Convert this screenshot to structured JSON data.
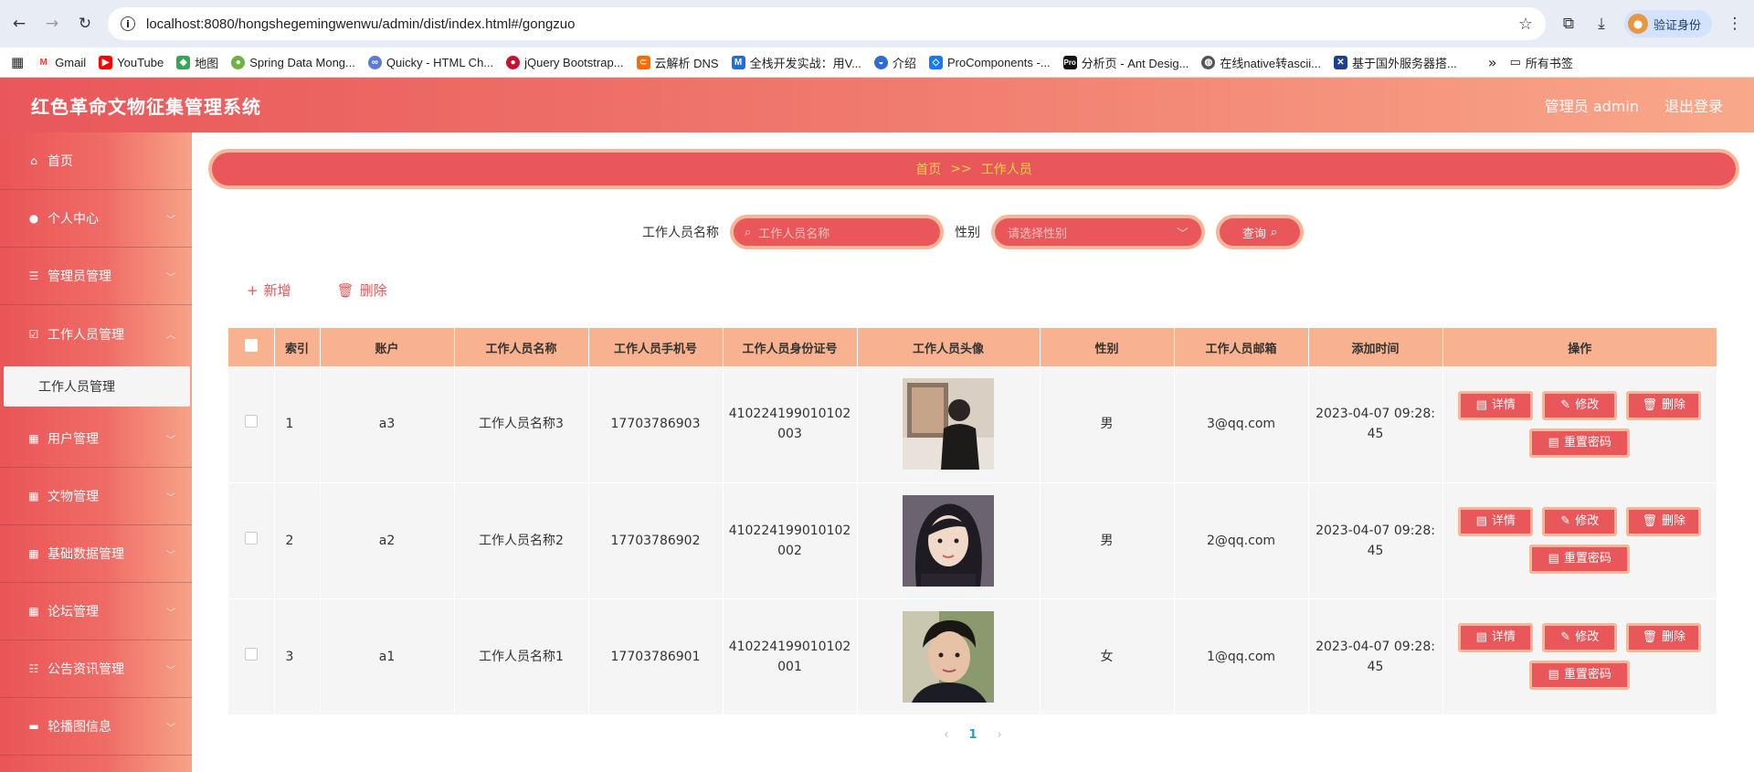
{
  "browser": {
    "url": "localhost:8080/hongshegemingwenwu/admin/dist/index.html#/gongzuo",
    "profile_label": "验证身份",
    "bookmarks": [
      "Gmail",
      "YouTube",
      "地图",
      "Spring Data Mong...",
      "Quicky - HTML Ch...",
      "jQuery Bootstrap...",
      "云解析 DNS",
      "全栈开发实战：用V...",
      "介绍",
      "ProComponents -...",
      "分析页 - Ant Desig...",
      "在线native转ascii...",
      "基于国外服务器搭..."
    ],
    "all_bookmarks": "所有书签",
    "overflow": "»"
  },
  "header": {
    "title": "红色革命文物征集管理系统",
    "admin_label": "管理员 admin",
    "logout": "退出登录"
  },
  "sidebar": {
    "items": [
      {
        "label": "首页",
        "icon": "home-icon"
      },
      {
        "label": "个人中心",
        "icon": "user-icon"
      },
      {
        "label": "管理员管理",
        "icon": "list-icon"
      },
      {
        "label": "工作人员管理",
        "icon": "check-icon"
      },
      {
        "label": "用户管理",
        "icon": "grid-icon"
      },
      {
        "label": "文物管理",
        "icon": "grid-icon"
      },
      {
        "label": "基础数据管理",
        "icon": "grid-icon"
      },
      {
        "label": "论坛管理",
        "icon": "grid-icon"
      },
      {
        "label": "公告资讯管理",
        "icon": "sliders-icon"
      },
      {
        "label": "轮播图信息",
        "icon": "monitor-icon"
      }
    ],
    "active_sub": "工作人员管理"
  },
  "breadcrumb": {
    "home": "首页",
    "sep": ">>",
    "current": "工作人员"
  },
  "search": {
    "name_label": "工作人员名称",
    "name_placeholder": "工作人员名称",
    "gender_label": "性别",
    "gender_placeholder": "请选择性别",
    "query_button": "查询"
  },
  "actions": {
    "add": "新增",
    "delete": "删除"
  },
  "table": {
    "headers": [
      "索引",
      "账户",
      "工作人员名称",
      "工作人员手机号",
      "工作人员身份证号",
      "工作人员头像",
      "性别",
      "工作人员邮箱",
      "添加时间",
      "操作"
    ],
    "rows": [
      {
        "index": "1",
        "account": "a3",
        "name": "工作人员名称3",
        "phone": "17703786903",
        "id_1": "410224199010102",
        "id_2": "003",
        "gender": "男",
        "email": "3@qq.com",
        "time_1": "2023-04-07 09:28:",
        "time_2": "45"
      },
      {
        "index": "2",
        "account": "a2",
        "name": "工作人员名称2",
        "phone": "17703786902",
        "id_1": "410224199010102",
        "id_2": "002",
        "gender": "男",
        "email": "2@qq.com",
        "time_1": "2023-04-07 09:28:",
        "time_2": "45"
      },
      {
        "index": "3",
        "account": "a1",
        "name": "工作人员名称1",
        "phone": "17703786901",
        "id_1": "410224199010102",
        "id_2": "001",
        "gender": "女",
        "email": "1@qq.com",
        "time_1": "2023-04-07 09:28:",
        "time_2": "45"
      }
    ],
    "ops": {
      "detail": "详情",
      "edit": "修改",
      "delete": "删除",
      "reset": "重置密码"
    }
  },
  "pager": {
    "prev": "‹",
    "page": "1",
    "next": "›"
  }
}
